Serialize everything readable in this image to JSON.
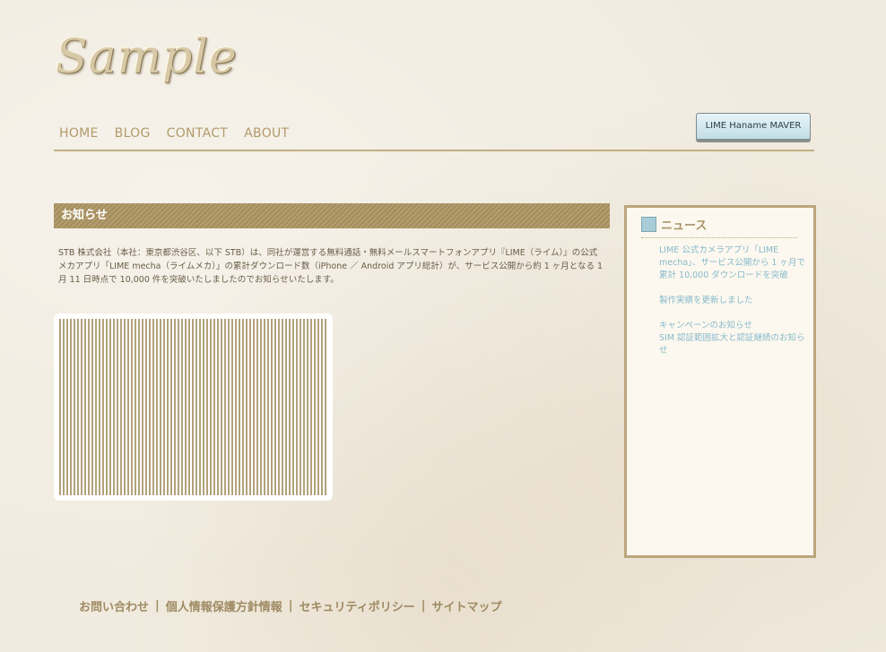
{
  "header": {
    "logo_text": "Sample",
    "nav": [
      "HOME",
      "BLOG",
      "CONTACT",
      "ABOUT"
    ],
    "button_label": "LIME Haname MAVER"
  },
  "main": {
    "heading": "お知らせ",
    "body": "STB 株式会社（本社：東京都渋谷区、以下 STB）は、同社が運営する無料通話・無料メールスマートフォンアプリ『LIME（ライム）』の公式メカアプリ「LIME mecha（ライムメカ）」の累計ダウンロード数（iPhone ／ Android アプリ総計）が、サービス公開から約 1 ヶ月となる 1 月 11 日時点で 10,000 件を突破いたしましたのでお知らせいたします。"
  },
  "sidebar": {
    "title": "ニュース",
    "items": [
      "LIME 公式カメラアプリ「LIME mecha」、サービス公開から 1 ヶ月で累計 10,000 ダウンロードを突破",
      "製作実績を更新しました",
      "キャンペーンのお知らせ",
      "SIM 認証範囲拡大と認証継続のお知らせ"
    ]
  },
  "footer": {
    "links": [
      "お問い合わせ",
      "個人情報保護方針情報",
      "セキュリティポリシー",
      "サイトマップ"
    ],
    "separator": "|"
  },
  "colors": {
    "accent_tan": "#b39e70",
    "sidebar_link": "#86b9cb",
    "nav_text": "#b29b6b"
  }
}
